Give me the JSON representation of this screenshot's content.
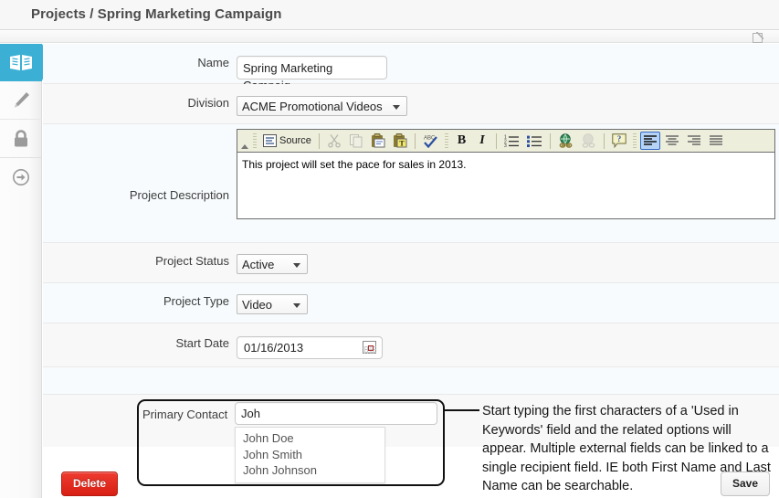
{
  "header": {
    "breadcrumb": "Projects / Spring Marketing Campaign",
    "edit_icon": "edit-square-icon"
  },
  "sidebar": {
    "items": [
      {
        "name": "book-icon",
        "label": "Details",
        "active": true
      },
      {
        "name": "pencil-icon",
        "label": "Edit",
        "active": false
      },
      {
        "name": "lock-icon",
        "label": "Permissions",
        "active": false
      },
      {
        "name": "arrow-right-circle-icon",
        "label": "Next",
        "active": false
      }
    ]
  },
  "form": {
    "name": {
      "label": "Name",
      "value": "Spring Marketing Campaig"
    },
    "division": {
      "label": "Division",
      "value": "ACME Promotional Videos"
    },
    "description": {
      "label": "Project Description",
      "value": "This project will set the pace for sales in 2013."
    },
    "status": {
      "label": "Project Status",
      "value": "Active"
    },
    "type": {
      "label": "Project Type",
      "value": "Video"
    },
    "start_date": {
      "label": "Start Date",
      "value": "01/16/2013",
      "icon": "calendar-icon"
    },
    "primary_contact": {
      "label": "Primary Contact",
      "value": "Joh",
      "suggestions": [
        "John Doe",
        "John Smith",
        "John Johnson"
      ]
    }
  },
  "editor": {
    "toolbar": [
      {
        "name": "source-button",
        "label": "Source",
        "type": "text"
      },
      {
        "name": "cut-icon",
        "label": "Cut",
        "type": "icon",
        "dim": true
      },
      {
        "name": "copy-icon",
        "label": "Copy",
        "type": "icon",
        "dim": true
      },
      {
        "name": "paste-icon",
        "label": "Paste",
        "type": "icon",
        "dim": false
      },
      {
        "name": "paste-text-icon",
        "label": "Paste as plain text",
        "type": "icon",
        "dim": false
      },
      {
        "name": "spellcheck-icon",
        "label": "Check Spelling",
        "type": "icon",
        "dim": false
      },
      {
        "name": "bold-button",
        "label": "B",
        "type": "text"
      },
      {
        "name": "italic-button",
        "label": "I",
        "type": "text"
      },
      {
        "name": "numbered-list-icon",
        "label": "Insert/Remove Numbered List",
        "type": "icon",
        "dim": false
      },
      {
        "name": "bulleted-list-icon",
        "label": "Insert/Remove Bulleted List",
        "type": "icon",
        "dim": false
      },
      {
        "name": "link-icon",
        "label": "Link",
        "type": "icon",
        "dim": false
      },
      {
        "name": "unlink-icon",
        "label": "Unlink",
        "type": "icon",
        "dim": true
      },
      {
        "name": "help-icon",
        "label": "About",
        "type": "icon",
        "dim": false
      },
      {
        "name": "align-left-icon",
        "label": "Align Left",
        "type": "icon",
        "active": true
      },
      {
        "name": "align-center-icon",
        "label": "Center",
        "type": "icon"
      },
      {
        "name": "align-right-icon",
        "label": "Align Right",
        "type": "icon"
      },
      {
        "name": "justify-icon",
        "label": "Justify",
        "type": "icon"
      }
    ]
  },
  "callout": {
    "note": "Start typing the first characters of a 'Used in Keywords' field and the related options will appear. Multiple external fields can be linked to a single recipient field. IE both First Name and Last Name can be searchable."
  },
  "actions": {
    "delete_label": "Delete",
    "save_label": "Save"
  },
  "colors": {
    "accent": "#3bafd4",
    "delete": "#d81f13",
    "toolbar_bg": "#eeeedd",
    "row_alt": "#f8f8f8",
    "row_lite": "#f7fbfd"
  }
}
